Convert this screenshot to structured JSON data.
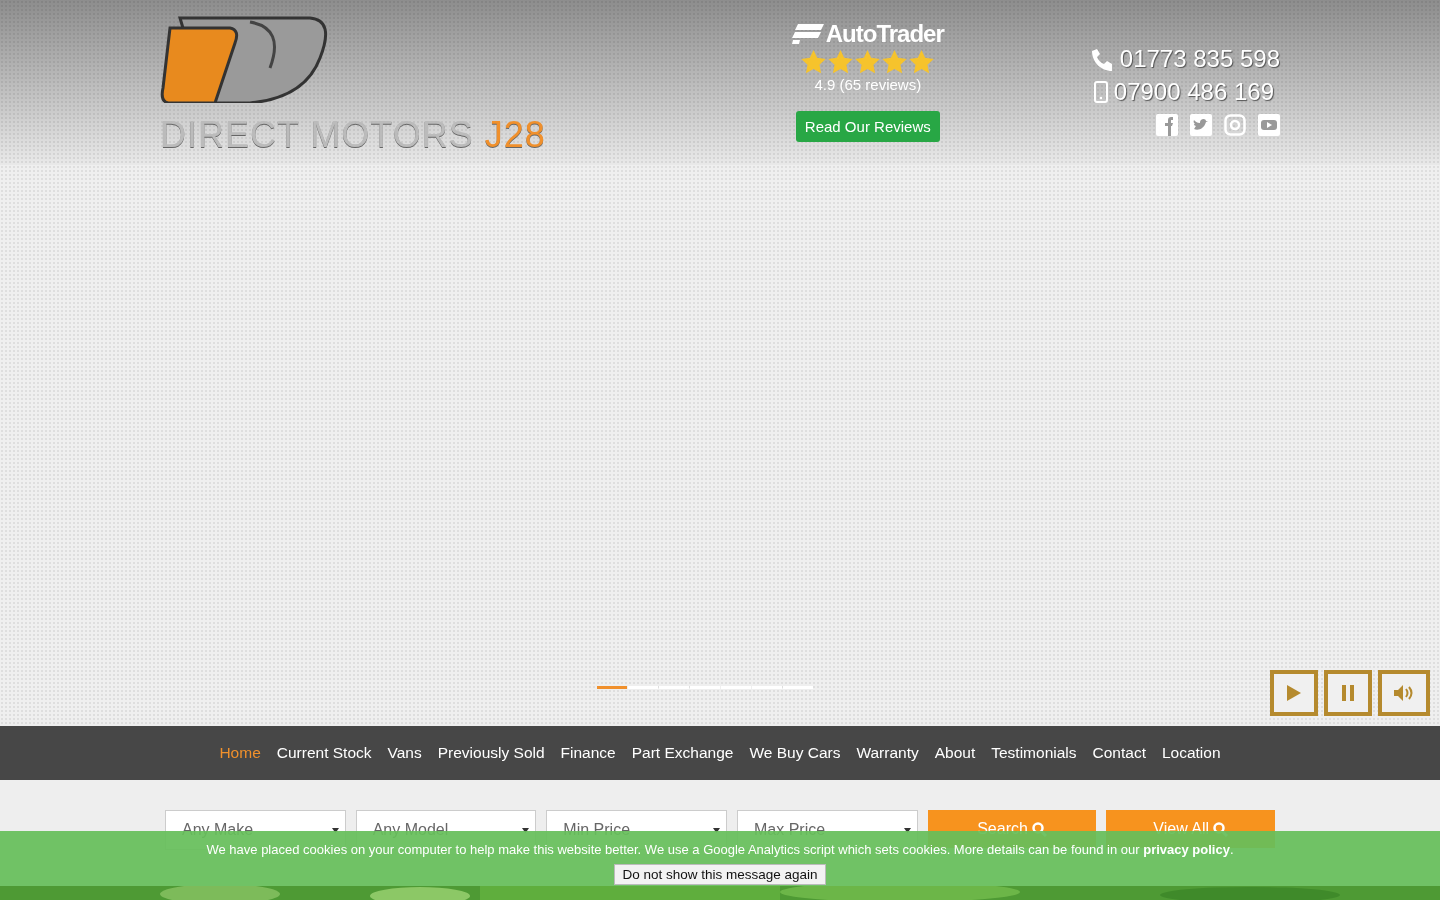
{
  "logo": {
    "name": "DIRECT MOTORS",
    "suffix": "J28"
  },
  "reviews": {
    "brand": "AutoTrader",
    "stars": 5,
    "rating": "4.9 (65 reviews)",
    "button": "Read Our Reviews"
  },
  "contact": {
    "phone": "01773 835 598",
    "mobile": "07900 486 169"
  },
  "slider": {
    "indicators": [
      {
        "selected": true
      },
      {
        "selected": false
      },
      {
        "selected": false
      },
      {
        "selected": false
      },
      {
        "selected": false
      },
      {
        "selected": false
      },
      {
        "selected": false
      }
    ]
  },
  "nav": [
    {
      "label": "Home",
      "selected": true
    },
    {
      "label": "Current Stock",
      "selected": false
    },
    {
      "label": "Vans",
      "selected": false
    },
    {
      "label": "Previously Sold",
      "selected": false
    },
    {
      "label": "Finance",
      "selected": false
    },
    {
      "label": "Part Exchange",
      "selected": false
    },
    {
      "label": "We Buy Cars",
      "selected": false
    },
    {
      "label": "Warranty",
      "selected": false
    },
    {
      "label": "About",
      "selected": false
    },
    {
      "label": "Testimonials",
      "selected": false
    },
    {
      "label": "Contact",
      "selected": false
    },
    {
      "label": "Location",
      "selected": false
    }
  ],
  "search": {
    "selects": [
      "Any Make",
      "Any Model",
      "Min Price",
      "Max Price"
    ],
    "buttons": [
      "Search",
      "View All"
    ]
  },
  "cookie": {
    "message": "We have placed cookies on your computer to help make this website better. We use a Google Analytics script which sets cookies. More details can be found in our **privacy policy**.",
    "button": "Do not show this message again"
  }
}
